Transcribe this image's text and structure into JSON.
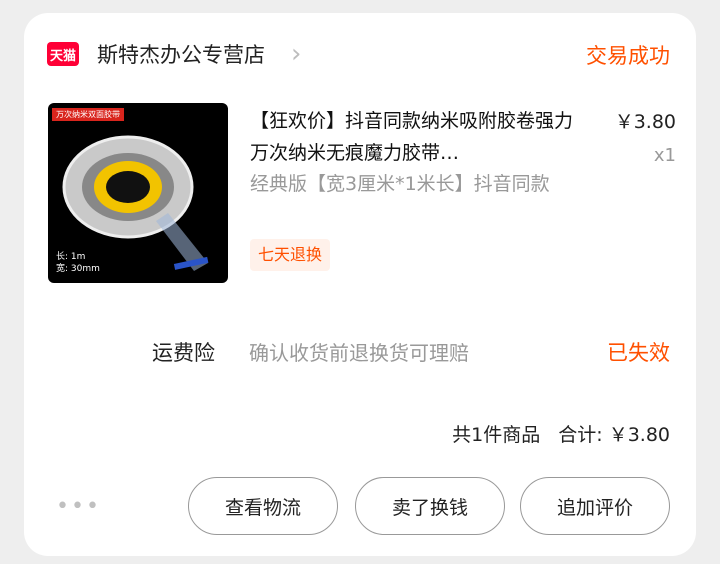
{
  "shop": {
    "badge": "天猫",
    "name": "斯特杰办公专营店",
    "chevron": "›"
  },
  "order_status": "交易成功",
  "product": {
    "image_banner": "万次纳米双面胶带",
    "image_spec_length": "长: 1m",
    "image_spec_width": "宽: 30mm",
    "title": "【狂欢价】抖音同款纳米吸附胶卷强力万次纳米无痕魔力胶带…",
    "price": "￥3.80",
    "quantity": "x1",
    "variant": "经典版【宽3厘米*1米长】抖音同款",
    "service_tag": "七天退换"
  },
  "insurance": {
    "label": "运费险",
    "description": "确认收货前退换货可理赔",
    "status": "已失效"
  },
  "summary": {
    "count": "共1件商品",
    "total_label": "合计:",
    "total_value": "￥3.80"
  },
  "more": "•••",
  "buttons": {
    "logistics": "查看物流",
    "resell": "卖了换钱",
    "review": "追加评价"
  }
}
